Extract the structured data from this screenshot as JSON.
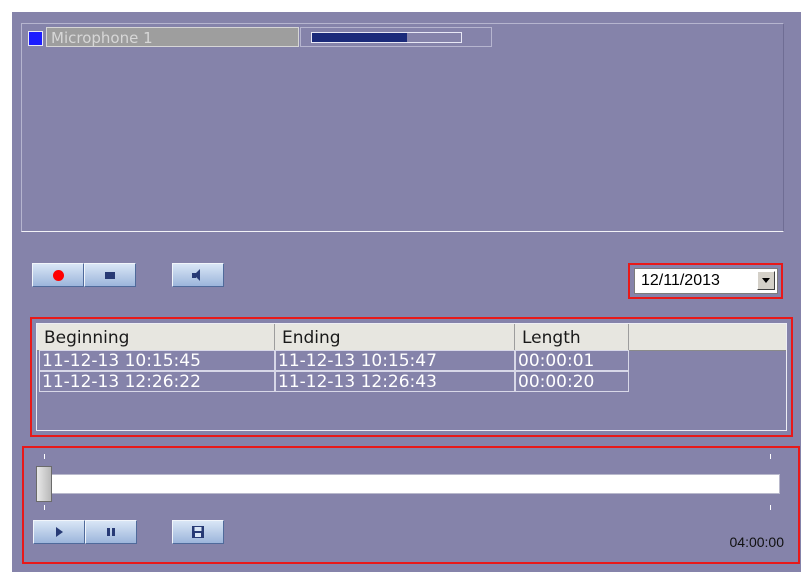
{
  "microphone": {
    "name": "Microphone 1",
    "swatch_color": "#1c1cff",
    "level_percent": 64,
    "level_color": "#1b2a7a"
  },
  "toolbar": {
    "record_icon": "record-icon",
    "stop_icon": "stop-icon",
    "speaker_icon": "speaker-icon"
  },
  "date_picker": {
    "value": "12/11/2013",
    "dropdown_icon": "chevron-down-icon"
  },
  "recordings": {
    "columns": [
      "Beginning",
      "Ending",
      "Length"
    ],
    "rows": [
      [
        "11-12-13 10:15:45",
        "11-12-13 10:15:47",
        "00:00:01"
      ],
      [
        "11-12-13 12:26:22",
        "11-12-13 12:26:43",
        "00:00:20"
      ]
    ]
  },
  "playback": {
    "position_percent": 0,
    "time": "04:00:00",
    "play_icon": "play-icon",
    "pause_icon": "pause-icon",
    "save_icon": "save-icon"
  },
  "colors": {
    "panel_bg": "#8583aa",
    "highlight_border": "#e81919"
  }
}
